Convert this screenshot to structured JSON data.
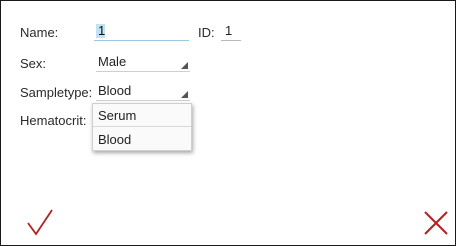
{
  "form": {
    "name_label": "Name:",
    "name_value": "1",
    "id_label": "ID:",
    "id_value": "1",
    "sex_label": "Sex:",
    "sex_value": "Male",
    "sampletype_label": "Sampletype:",
    "sampletype_value": "Blood",
    "hematocrit_label": "Hematocrit:"
  },
  "dropdown": {
    "options": [
      "Serum",
      "Blood"
    ]
  },
  "actions": {
    "confirm_icon": "checkmark-icon",
    "cancel_icon": "close-x-icon",
    "accent_color": "#b22222"
  }
}
